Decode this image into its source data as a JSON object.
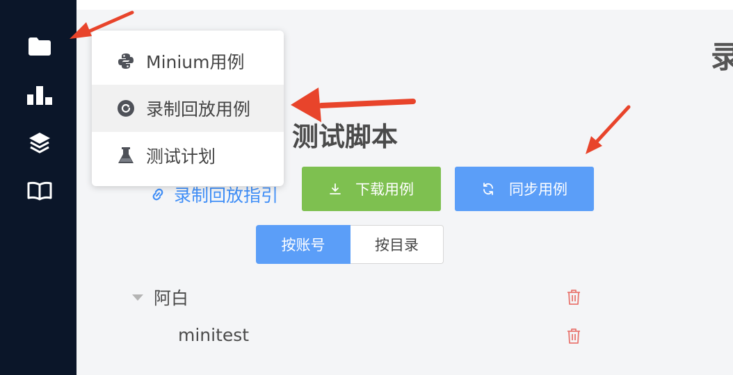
{
  "menu": {
    "items": [
      {
        "label": "Minium用例",
        "icon": "python-icon"
      },
      {
        "label": "录制回放用例",
        "icon": "record-replay-icon"
      },
      {
        "label": "测试计划",
        "icon": "flask-icon"
      }
    ]
  },
  "page": {
    "title_fragment": "录"
  },
  "section": {
    "title": "测试脚本",
    "guide_link": "录制回放指引"
  },
  "actions": {
    "download_label": "下载用例",
    "sync_label": "同步用例"
  },
  "view_toggle": {
    "options": [
      "按账号",
      "按目录"
    ],
    "selected": "按账号"
  },
  "tree": {
    "groups": [
      {
        "name": "阿白",
        "expanded": true,
        "children": [
          {
            "name": "minitest"
          }
        ]
      }
    ]
  },
  "colors": {
    "sidebar_bg": "#0b1629",
    "download_green": "#7ec050",
    "sync_blue": "#5b9ef8",
    "link_blue": "#3f8ef7",
    "delete_red": "#e8756f",
    "annotation_arrow": "#e8442b"
  }
}
